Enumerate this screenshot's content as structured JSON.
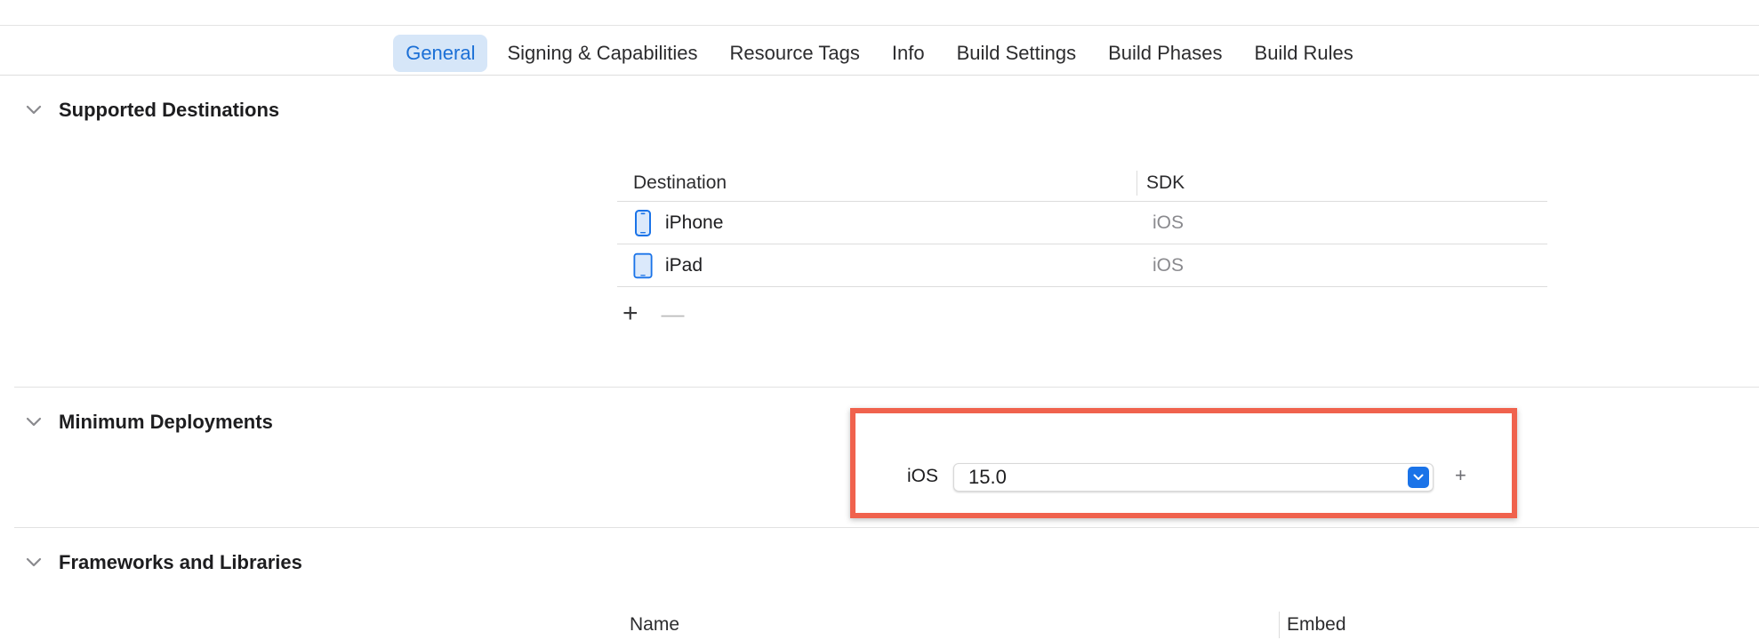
{
  "tabs": [
    {
      "label": "General",
      "active": true
    },
    {
      "label": "Signing & Capabilities",
      "active": false
    },
    {
      "label": "Resource Tags",
      "active": false
    },
    {
      "label": "Info",
      "active": false
    },
    {
      "label": "Build Settings",
      "active": false
    },
    {
      "label": "Build Phases",
      "active": false
    },
    {
      "label": "Build Rules",
      "active": false
    }
  ],
  "sections": {
    "supported_destinations": {
      "title": "Supported Destinations",
      "columns": {
        "destination": "Destination",
        "sdk": "SDK"
      },
      "rows": [
        {
          "destination": "iPhone",
          "sdk": "iOS",
          "icon": "iphone-icon"
        },
        {
          "destination": "iPad",
          "sdk": "iOS",
          "icon": "ipad-icon"
        }
      ],
      "add_label": "+",
      "remove_label": "—"
    },
    "minimum_deployments": {
      "title": "Minimum Deployments",
      "platform_label": "iOS",
      "version": "15.0",
      "add_label": "+"
    },
    "frameworks": {
      "title": "Frameworks and Libraries",
      "columns": {
        "name": "Name",
        "embed": "Embed"
      }
    }
  },
  "colors": {
    "accent": "#1a73e8",
    "active_tab_bg": "#d6e6f8",
    "highlight": "#f0624d"
  }
}
